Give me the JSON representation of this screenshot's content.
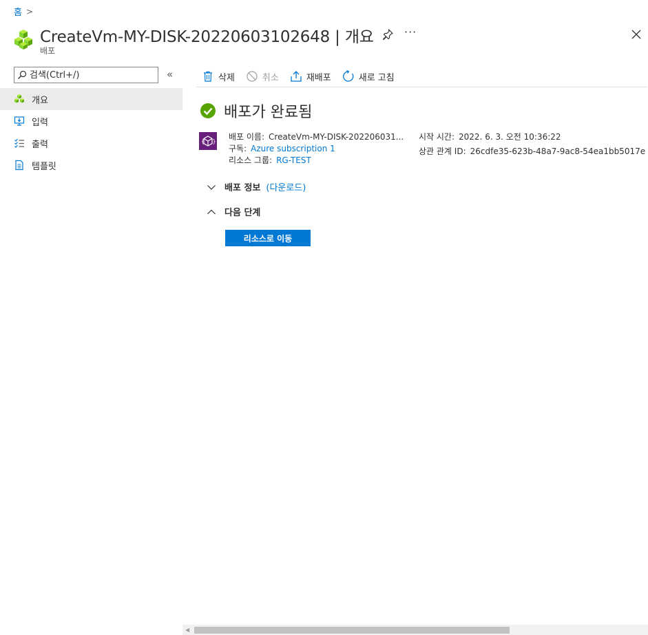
{
  "breadcrumb": {
    "home": "홈",
    "separator": ">"
  },
  "header": {
    "title": "CreateVm-MY-DISK-20220603102648 | 개요",
    "subtitle": "배포",
    "more": "···"
  },
  "sidebar": {
    "search_placeholder": "검색(Ctrl+/)",
    "collapse": "«",
    "items": [
      {
        "label": "개요",
        "icon": "overview-icon",
        "active": true
      },
      {
        "label": "입력",
        "icon": "inputs-icon"
      },
      {
        "label": "출력",
        "icon": "outputs-icon"
      },
      {
        "label": "템플릿",
        "icon": "template-icon"
      }
    ]
  },
  "toolbar": {
    "delete": "삭제",
    "cancel": "취소",
    "redeploy": "재배포",
    "refresh": "새로 고침"
  },
  "main": {
    "status": "배포가 완료됨",
    "deployment_name_label": "배포 이름:",
    "deployment_name": "CreateVm-MY-DISK-202206031...",
    "subscription_label": "구독:",
    "subscription": "Azure subscription 1",
    "resource_group_label": "리소스 그룹:",
    "resource_group": "RG-TEST",
    "start_time_label": "시작 시간:",
    "start_time": "2022. 6. 3. 오전 10:36:22",
    "correlation_label": "상관 관계 ID:",
    "correlation_id": "26cdfe35-623b-48a7-9ac8-54ea1bb5017e",
    "deployment_details": "배포 정보",
    "download": "(다운로드)",
    "next_steps": "다음 단계",
    "go_to_resource": "리소스로 이동"
  },
  "colors": {
    "accent": "#0078d4",
    "success": "#57a300",
    "deploy_icon": "#68217a"
  }
}
